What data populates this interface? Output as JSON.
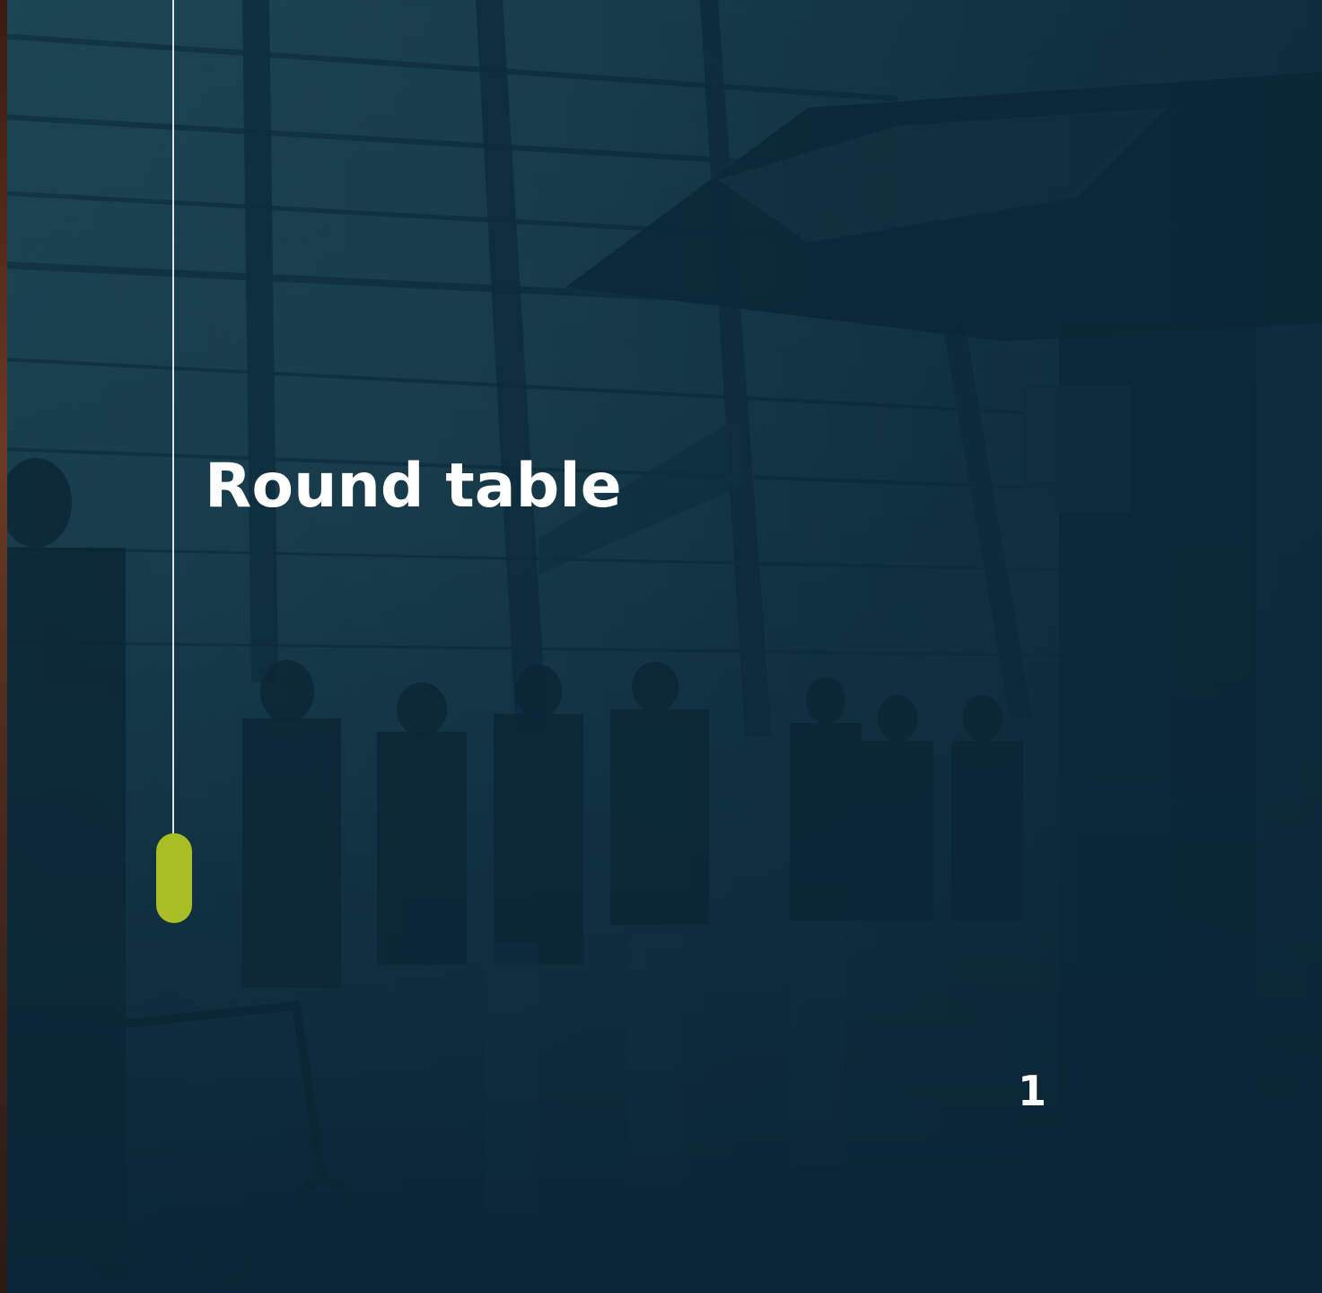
{
  "slide": {
    "title": "Round table",
    "page_number": "1"
  },
  "colors": {
    "background": "#17404f",
    "accent": "#a9bd25",
    "text": "#ffffff",
    "timeline_line": "#d9e4e8"
  },
  "background_image": {
    "description_icon": "airport-terminal-silhouette-image"
  }
}
